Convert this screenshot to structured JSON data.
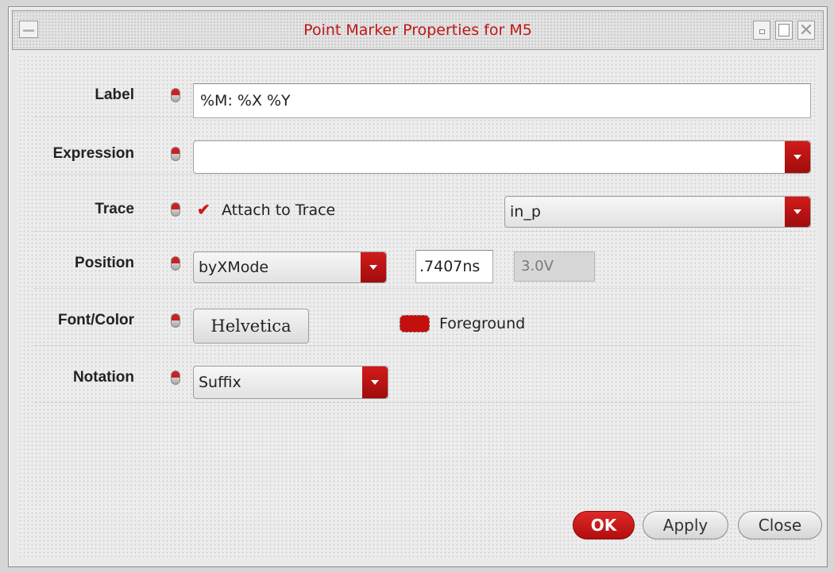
{
  "window": {
    "title": "Point Marker Properties for M5"
  },
  "form": {
    "label": {
      "label": "Label",
      "value": "%M: %X %Y"
    },
    "expression": {
      "label": "Expression",
      "value": ""
    },
    "trace": {
      "label": "Trace",
      "attach_label": "Attach to Trace",
      "attach_checked": true,
      "selected": "in_p"
    },
    "position": {
      "label": "Position",
      "mode": "byXMode",
      "x_value": ".7407ns",
      "y_value": "3.0V"
    },
    "font_color": {
      "label": "Font/Color",
      "font": "Helvetica",
      "color_label": "Foreground",
      "color": "#c40f0f"
    },
    "notation": {
      "label": "Notation",
      "selected": "Suffix"
    }
  },
  "buttons": {
    "ok": "OK",
    "apply": "Apply",
    "close": "Close"
  },
  "colors": {
    "accent": "#c01818",
    "ok_button": "#c81818"
  }
}
